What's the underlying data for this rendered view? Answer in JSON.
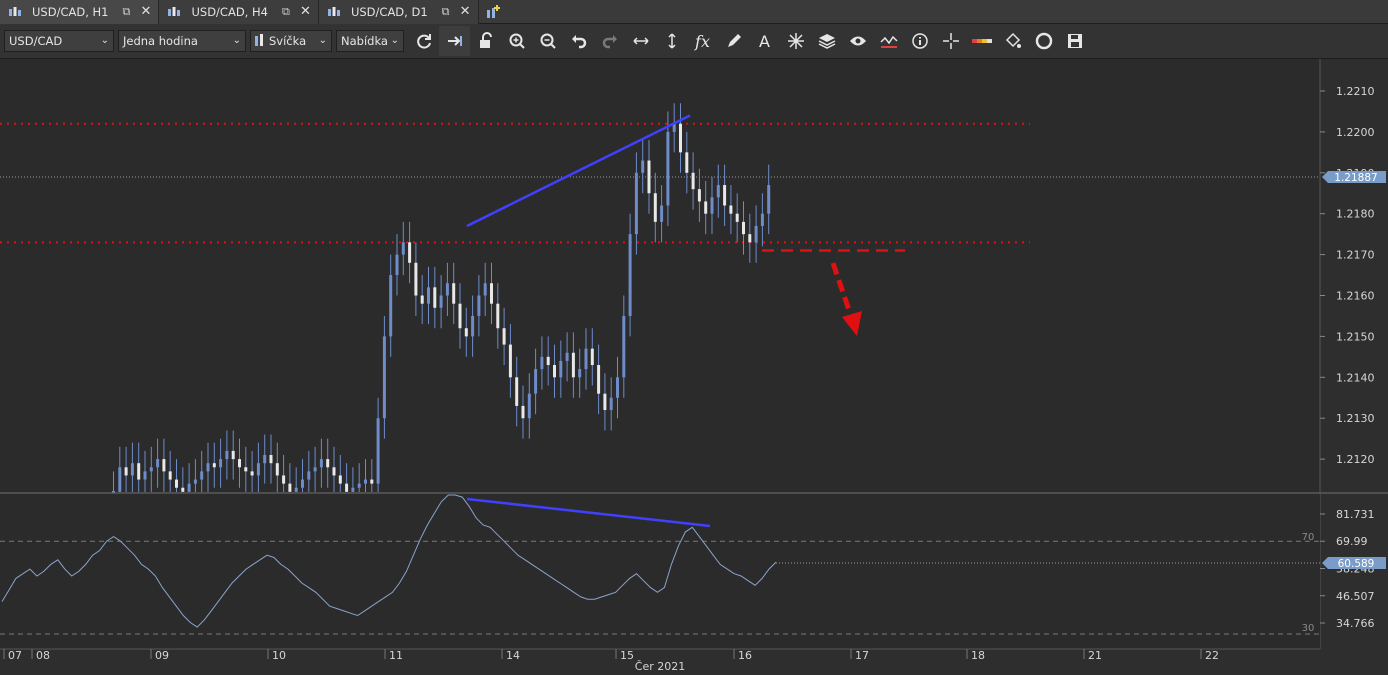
{
  "tabs": [
    {
      "label": "USD/CAD, H1",
      "active": true
    },
    {
      "label": "USD/CAD, H4",
      "active": false
    },
    {
      "label": "USD/CAD, D1",
      "active": false
    }
  ],
  "toolbar": {
    "instrument": "USD/CAD",
    "period": "Jedna hodina",
    "chart_type": "Svíčka",
    "offer_side": "Nabídka",
    "tools": [
      "refresh-icon",
      "shift-chart-icon",
      "lock-icon",
      "zoom-in-icon",
      "zoom-out-icon",
      "undo-icon",
      "redo-icon",
      "fit-horizontal-icon",
      "fit-vertical-icon",
      "function-icon",
      "pencil-icon",
      "text-icon",
      "crosshair-icon",
      "layers-icon",
      "eye-icon",
      "indicator-icon",
      "info-icon",
      "cursor-icon",
      "color-scale-icon",
      "fill-bucket-icon",
      "template-icon",
      "save-icon"
    ]
  },
  "colors": {
    "background": "#2b2b2b",
    "candle": "#e8e8e8",
    "candle_up_wick": "#6d8cc9",
    "trendline": "#4040ff",
    "support_resistance": "#e01010",
    "arrow": "#e01010",
    "rsi_line": "#8aa4cc"
  },
  "price_axis": {
    "ticks": [
      "1.2210",
      "1.2200",
      "1.2190",
      "1.2180",
      "1.2170",
      "1.2160",
      "1.2150",
      "1.2140",
      "1.2130",
      "1.2120"
    ],
    "current_price": "1.21887"
  },
  "rsi_axis": {
    "ticks": [
      "81.731",
      "69.99",
      "58.248",
      "46.507",
      "34.766"
    ],
    "current_value": "60.589",
    "upper_level": "70",
    "lower_level": "30"
  },
  "time_axis": {
    "labels": [
      "07",
      "08",
      "09",
      "10",
      "11",
      "14",
      "15",
      "16",
      "17",
      "18",
      "21",
      "22"
    ],
    "month_label": "Čer 2021"
  },
  "chart_data": {
    "type": "line",
    "title": "",
    "price_levels_dotted": [
      1.2202,
      1.2173
    ],
    "breakout_level_dashed": 1.2171,
    "trendline_price": {
      "from": 1.2177,
      "to": 1.2204
    },
    "trendline_rsi": {
      "from": 91,
      "to": 75
    },
    "close_series": [
      1.2112,
      1.2118,
      1.2116,
      1.2119,
      1.2115,
      1.2117,
      1.2118,
      1.212,
      1.2117,
      1.2115,
      1.2113,
      1.2112,
      1.2114,
      1.2115,
      1.2117,
      1.2119,
      1.2118,
      1.212,
      1.2122,
      1.212,
      1.2118,
      1.2117,
      1.2116,
      1.2119,
      1.2121,
      1.2119,
      1.2116,
      1.2114,
      1.2112,
      1.2113,
      1.2115,
      1.2117,
      1.2118,
      1.212,
      1.2118,
      1.2116,
      1.2114,
      1.2112,
      1.2113,
      1.2114,
      1.2115,
      1.2114,
      1.213,
      1.215,
      1.2165,
      1.217,
      1.2173,
      1.2168,
      1.216,
      1.2158,
      1.2162,
      1.2157,
      1.216,
      1.2163,
      1.2158,
      1.2152,
      1.215,
      1.2155,
      1.216,
      1.2163,
      1.2158,
      1.2152,
      1.2148,
      1.214,
      1.2133,
      1.213,
      1.2136,
      1.2142,
      1.2145,
      1.2143,
      1.214,
      1.2144,
      1.2146,
      1.214,
      1.2142,
      1.2147,
      1.2143,
      1.2136,
      1.2132,
      1.2135,
      1.214,
      1.2155,
      1.2175,
      1.219,
      1.2193,
      1.2185,
      1.2178,
      1.2182,
      1.22,
      1.2202,
      1.2195,
      1.219,
      1.2186,
      1.2183,
      1.218,
      1.2184,
      1.2187,
      1.2182,
      1.218,
      1.2178,
      1.2175,
      1.2173,
      1.2177,
      1.218,
      1.2187
    ],
    "rsi_series": [
      44,
      49,
      54,
      56,
      58,
      55,
      57,
      60,
      62,
      58,
      55,
      57,
      60,
      64,
      66,
      70,
      72,
      70,
      67,
      64,
      60,
      58,
      55,
      50,
      46,
      42,
      38,
      35,
      33,
      36,
      40,
      44,
      48,
      52,
      55,
      58,
      60,
      62,
      64,
      63,
      60,
      58,
      55,
      52,
      50,
      48,
      45,
      42,
      41,
      40,
      39,
      38,
      40,
      42,
      44,
      46,
      48,
      52,
      57,
      64,
      71,
      77,
      82,
      87,
      90,
      91,
      89,
      85,
      80,
      77,
      76,
      73,
      70,
      67,
      64,
      62,
      60,
      58,
      56,
      54,
      52,
      50,
      48,
      46,
      45,
      45,
      46,
      47,
      48,
      51,
      54,
      56,
      53,
      50,
      48,
      50,
      60,
      68,
      74,
      76,
      72,
      68,
      64,
      60,
      58,
      56,
      55,
      53,
      51,
      54,
      58,
      61
    ]
  }
}
